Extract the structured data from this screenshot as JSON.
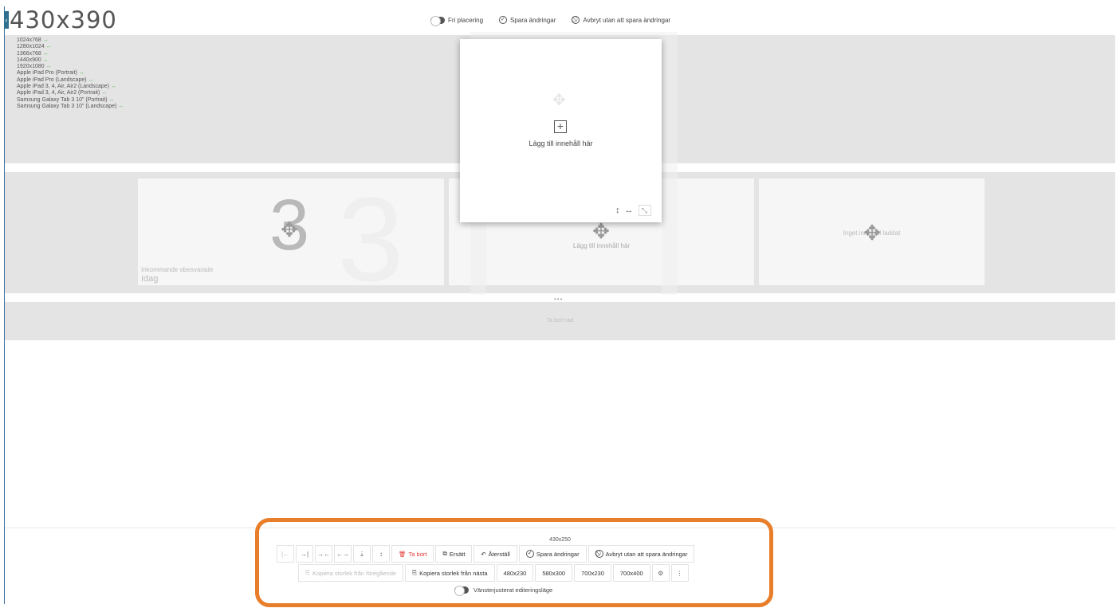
{
  "header": {
    "size_title": "430x390"
  },
  "top_toolbar": {
    "free_placement": "Fri placering",
    "save": "Spara ändringar",
    "cancel": "Avbryt utan att spara ändringar"
  },
  "resolutions": [
    "1024x768",
    "1280x1024",
    "1366x768",
    "1440x900",
    "1920x1080",
    "Apple iPad Pro (Portrait)",
    "Apple iPad Pro (Landscape)",
    "Apple iPad 3, 4, Air, Air2 (Landscape)",
    "Apple iPad 3, 4, Air, Air2 (Portrait)",
    "Samsung Galaxy Tab 3 10\" (Portrait)",
    "Samsung Galaxy Tab 3 10\" (Landscape)"
  ],
  "resolution_link_glyph": "↔",
  "cards": {
    "card1": {
      "number": "3",
      "caption": "Inkommande obesvarade",
      "subcaption": "Idag"
    },
    "card2": {
      "text": "Lägg till innehåll här"
    },
    "card3": {
      "text": "Inget innehåll laddat"
    }
  },
  "popup": {
    "plus": "+",
    "text": "Lägg till innehåll här"
  },
  "bottom_band": {
    "label": "Ta bort rad"
  },
  "bottom_toolbar": {
    "size": "430x250",
    "row1": {
      "align_left": "|←",
      "align_right": "→|",
      "shrink_h": "→←",
      "expand_h": "←→",
      "shrink_v": "⇣",
      "expand_v": "↕",
      "delete": "Ta bort",
      "replace": "Ersätt",
      "reset": "Återställ",
      "save": "Spara ändringar",
      "cancel": "Avbryt utan att spara ändringar"
    },
    "row2": {
      "copy_prev": "Kopiera storlek från föregående",
      "copy_next": "Kopiera storlek från nästa",
      "s1": "480x230",
      "s2": "580x300",
      "s3": "700x230",
      "s4": "700x400",
      "settings": "⚙",
      "more": "⋮"
    },
    "left_edit_mode": "Vänsterjusterat editeringsläge"
  },
  "colors": {
    "highlight": "#e87d2a",
    "danger": "#e53935",
    "link": "#5cb85c"
  }
}
